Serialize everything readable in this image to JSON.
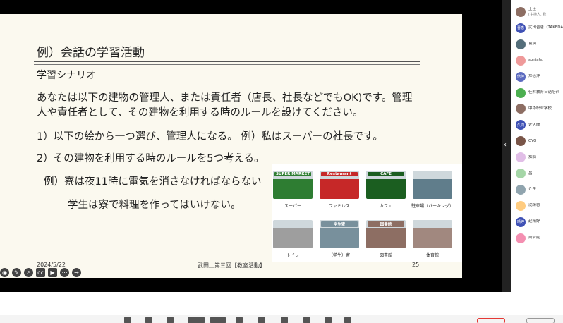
{
  "slide": {
    "title": "例）会話の学習活動",
    "subtitle": "学習シナリオ",
    "paragraph": "あなたは以下の建物の管理人、または責任者（店長、社長などでもOK)です。管理人や責任者として、その建物を利用する時のルールを設けてください。",
    "step1": "1）以下の絵から一つ選び、管理人になる。 例）私はスーパーの社長です。",
    "step2": "2）その建物を利用する時のルールを5つ考える。",
    "example1": "例）寮は夜11時に電気を消さなければならない",
    "example2": "学生は寮で料理を作ってはいけない。",
    "footer_date": "2024/5/22",
    "footer_center": "武田＿第三回【教室活動】",
    "footer_page": "25"
  },
  "buildings": [
    {
      "caption": "スーパー",
      "sign": "SUPER MARKET",
      "color": "#2e7d32"
    },
    {
      "caption": "ファミレス",
      "sign": "Restaurant",
      "color": "#c62828"
    },
    {
      "caption": "カフェ",
      "sign": "CAFE",
      "color": "#1b5e20"
    },
    {
      "caption": "駐車場（パーキング）",
      "sign": "",
      "color": "#607d8b"
    },
    {
      "caption": "トイレ",
      "sign": "",
      "color": "#9e9e9e"
    },
    {
      "caption": "（学生）寮",
      "sign": "学生寮",
      "color": "#78909c"
    },
    {
      "caption": "図書館",
      "sign": "図書館",
      "color": "#8d6e63"
    },
    {
      "caption": "体育館",
      "sign": "",
      "color": "#a1887f"
    }
  ],
  "participants": [
    {
      "name": "王佳",
      "sub": "(主持人, 我)",
      "color": "#8d6e63",
      "initial": ""
    },
    {
      "name": "武田晋恵（TAKEDA",
      "sub": "",
      "color": "#3f51b5",
      "initial": "晋恵"
    },
    {
      "name": "袁玥",
      "sub": "",
      "color": "#546e7a",
      "initial": ""
    },
    {
      "name": "sonia阮",
      "sub": "",
      "color": "#ef9a9a",
      "initial": ""
    },
    {
      "name": "郑倍萍",
      "sub": "",
      "color": "#5c6bc0",
      "initial": "倍萍"
    },
    {
      "name": "仕林教育日语培训",
      "sub": "",
      "color": "#4caf50",
      "initial": ""
    },
    {
      "name": "中华职业学校",
      "sub": "",
      "color": "#8d6e63",
      "initial": ""
    },
    {
      "name": "佐久間",
      "sub": "",
      "color": "#3f51b5",
      "initial": "久間"
    },
    {
      "name": "OYO",
      "sub": "",
      "color": "#795548",
      "initial": ""
    },
    {
      "name": "痴痴",
      "sub": "",
      "color": "#e1bee7",
      "initial": ""
    },
    {
      "name": "昌",
      "sub": "",
      "color": "#a5d6a7",
      "initial": ""
    },
    {
      "name": "芥蒂",
      "sub": "",
      "color": "#90a4ae",
      "initial": ""
    },
    {
      "name": "沈臻蓉",
      "sub": "",
      "color": "#ffcc80",
      "initial": ""
    },
    {
      "name": "赵晴婷",
      "sub": "",
      "color": "#3f51b5",
      "initial": "晴婷"
    },
    {
      "name": "周梦妮",
      "sub": "",
      "color": "#f48fb1",
      "initial": ""
    }
  ]
}
